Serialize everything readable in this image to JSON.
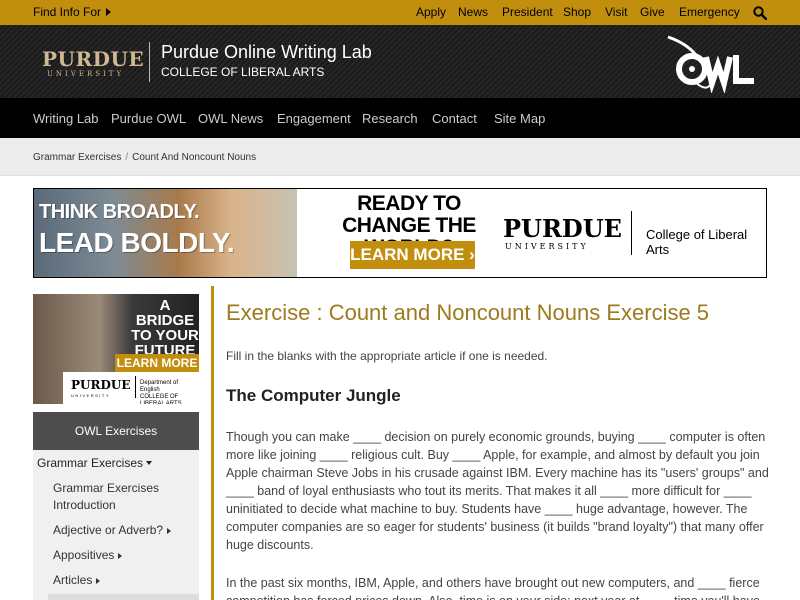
{
  "topbar": {
    "find_info": "Find Info For",
    "links": [
      "Apply",
      "News",
      "President",
      "Shop",
      "Visit",
      "Give",
      "Emergency"
    ]
  },
  "header": {
    "logo_main": "PURDUE",
    "logo_sub": "UNIVERSITY",
    "title": "Purdue Online Writing Lab",
    "subtitle": "COLLEGE OF LIBERAL ARTS",
    "owl_logo": "OWL"
  },
  "nav": {
    "items": [
      "Writing Lab",
      "Purdue OWL",
      "OWL News",
      "Engagement",
      "Research",
      "Contact",
      "Site Map"
    ]
  },
  "breadcrumb": {
    "items": [
      "Grammar Exercises",
      "Count And Noncount Nouns"
    ],
    "separator": "/"
  },
  "banner": {
    "line1": "THINK BROADLY.",
    "line2": "LEAD BOLDLY.",
    "headline": "READY TO CHANGE THE WORLD?",
    "cta": "LEARN MORE ›",
    "logo_main": "PURDUE",
    "logo_sub": "UNIVERSITY",
    "college": "College of Liberal Arts"
  },
  "sidebar": {
    "ad": {
      "headline": "A BRIDGE TO YOUR FUTURE",
      "cta": "LEARN MORE ›",
      "logo_main": "PURDUE",
      "logo_sub": "UNIVERSITY",
      "dept_line1": "Department of English",
      "dept_line2": "COLLEGE OF LIBERAL ARTS"
    },
    "menu_title": "OWL Exercises",
    "group": "Grammar Exercises",
    "items": [
      "Grammar Exercises Introduction",
      "Adjective or Adverb?",
      "Appositives",
      "Articles"
    ]
  },
  "content": {
    "title": "Exercise : Count and Noncount Nouns Exercise 5",
    "instructions": "Fill in the blanks with the appropriate article if one is needed.",
    "subtitle": "The Computer Jungle",
    "paragraph1": "Though you can make ____ decision on purely economic grounds, buying ____ computer is often more like joining ____ religious cult. Buy ____ Apple, for example, and almost by default you join Apple chairman Steve Jobs in his crusade against IBM. Every machine has its \"users' groups\" and ____ band of loyal enthusiasts who tout its merits. That makes it all ____ more difficult for ____ uninitiated to decide what machine to buy. Students have ____ huge advantage, however. The computer companies are so eager for students' business (it builds \"brand loyalty\") that many offer huge discounts.",
    "paragraph2": "In the past six months, IBM, Apple, and others have brought out new computers, and ____ fierce competition has forced prices down. Also, time is on your side: next year at ____ time you'll have"
  },
  "colors": {
    "gold": "#c28e0e",
    "title_gold": "#9d7a1f",
    "nav_bg": "#000000",
    "header_bg": "#1e1e1e"
  }
}
